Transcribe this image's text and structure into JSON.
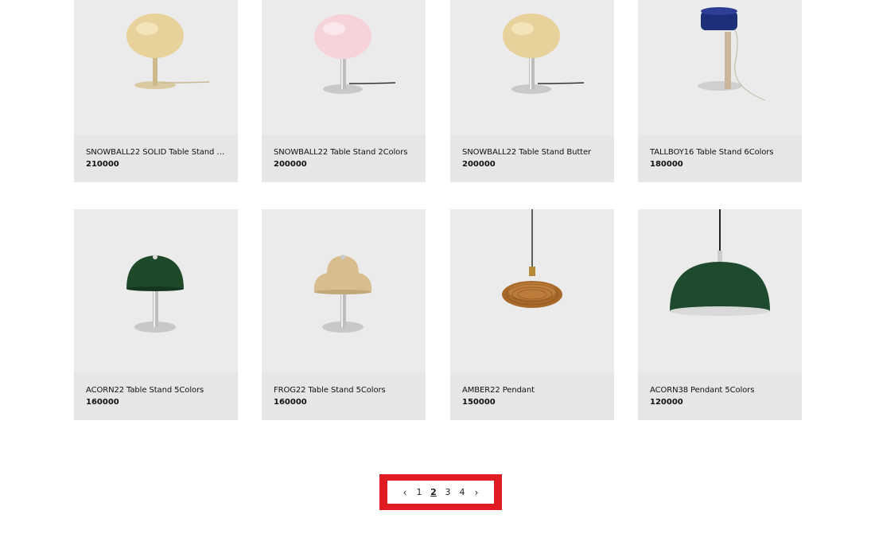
{
  "products": [
    {
      "name": "SNOWBALL22 SOLID Table Stand All ...",
      "price": "210000"
    },
    {
      "name": "SNOWBALL22 Table Stand 2Colors",
      "price": "200000"
    },
    {
      "name": "SNOWBALL22 Table Stand Butter",
      "price": "200000"
    },
    {
      "name": "TALLBOY16 Table Stand 6Colors",
      "price": "180000"
    },
    {
      "name": "ACORN22 Table Stand 5Colors",
      "price": "160000"
    },
    {
      "name": "FROG22 Table Stand 5Colors",
      "price": "160000"
    },
    {
      "name": "AMBER22 Pendant",
      "price": "150000"
    },
    {
      "name": "ACORN38 Pendant 5Colors",
      "price": "120000"
    }
  ],
  "pagination": {
    "prev": "‹",
    "pages": [
      "1",
      "2",
      "3",
      "4"
    ],
    "current": "2",
    "next": "›"
  },
  "colors": {
    "highlight": "#e01c22",
    "card_bg": "#ebebeb",
    "info_bg": "#e6e6e6"
  }
}
